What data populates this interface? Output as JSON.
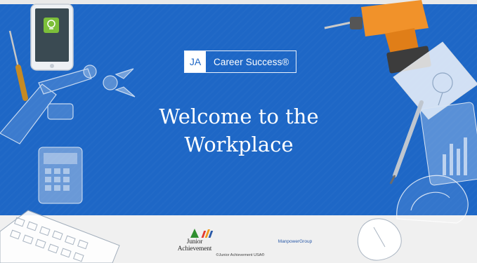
{
  "slide": {
    "badge": {
      "ja": "JA",
      "label": "Career Success®"
    },
    "title_line1": "Welcome to the",
    "title_line2": "Workplace",
    "footer": {
      "logo_left": "Junior Achievement",
      "logo_right": "ManpowerGroup",
      "copyright": "©Junior Achievement USA®"
    }
  },
  "colors": {
    "background_blue": "#1e67c6",
    "footer_gray": "#f0f0f0",
    "ja_green": "#2f8f2f",
    "manpower_red": "#e23a2e",
    "manpower_orange": "#f29a1e",
    "manpower_blue": "#2a5aa8"
  },
  "icons": [
    "smartphone-icon",
    "lightbulb-icon",
    "screwdriver-icon",
    "robot-arm-icon",
    "calculator-icon",
    "keyboard-icon",
    "power-drill-icon",
    "notepad-icon",
    "pencil-icon",
    "tablet-icon",
    "hard-hat-icon",
    "mouse-icon"
  ]
}
